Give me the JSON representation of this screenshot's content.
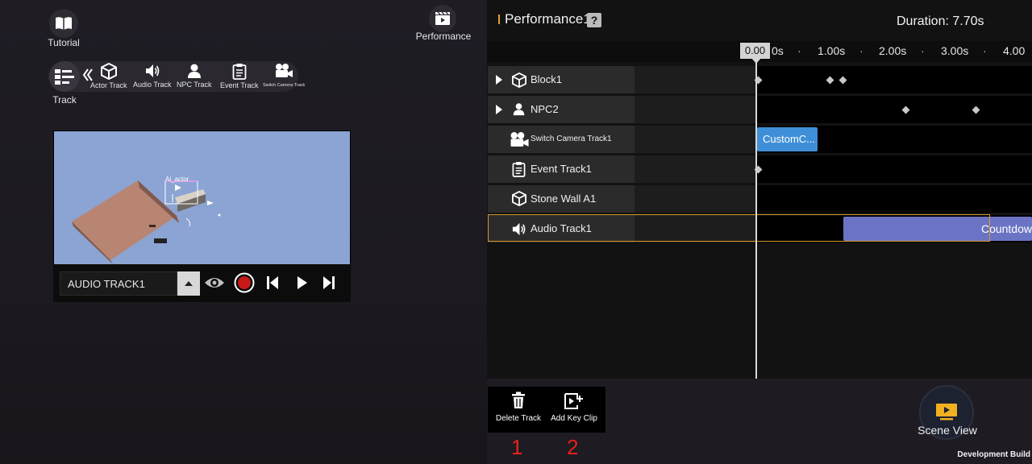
{
  "left": {
    "tutorial_label": "Tutorial",
    "performance_label": "Performance",
    "track_label": "Track",
    "toolbar": [
      {
        "label": "Actor Track",
        "icon": "cube-icon"
      },
      {
        "label": "Audio Track",
        "icon": "speaker-icon"
      },
      {
        "label": "NPC Track",
        "icon": "npc-icon"
      },
      {
        "label": "Event Track",
        "icon": "clipboard-icon"
      },
      {
        "label": "Switch Camera Track",
        "icon": "movie-camera-icon"
      }
    ],
    "preview": {
      "scene_label": "Ai_actor",
      "track_name": "AUDIO TRACK1"
    }
  },
  "header": {
    "title": "Performance1",
    "help": "?",
    "duration": "Duration: 7.70s"
  },
  "ruler": {
    "current": "0.00",
    "ticks": [
      "0s",
      "1.00s",
      "2.00s",
      "3.00s",
      "4.00"
    ],
    "separator": "·"
  },
  "tracks": [
    {
      "name": "Block1",
      "icon": "cube-icon",
      "expandable": true
    },
    {
      "name": "NPC2",
      "icon": "npc-icon",
      "expandable": true
    },
    {
      "name": "Switch Camera Track1",
      "icon": "movie-camera-icon",
      "expandable": false,
      "clip": "CustomC..."
    },
    {
      "name": "Event Track1",
      "icon": "clipboard-icon",
      "expandable": false
    },
    {
      "name": "Stone Wall A1",
      "icon": "cube-icon",
      "expandable": false
    },
    {
      "name": "Audio Track1",
      "icon": "speaker-icon",
      "expandable": false,
      "clip": "Countdow",
      "selected": true
    }
  ],
  "actions": {
    "delete_label": "Delete Track",
    "add_key_label": "Add Key Clip",
    "marker1": "1",
    "marker2": "2"
  },
  "scene_view_label": "Scene View",
  "dev_build": "Development Build",
  "colors": {
    "accent_orange": "#e0a030",
    "clip_blue": "#3f8fd8",
    "clip_purple": "#6b73c4",
    "marker_red": "#e8201c"
  }
}
